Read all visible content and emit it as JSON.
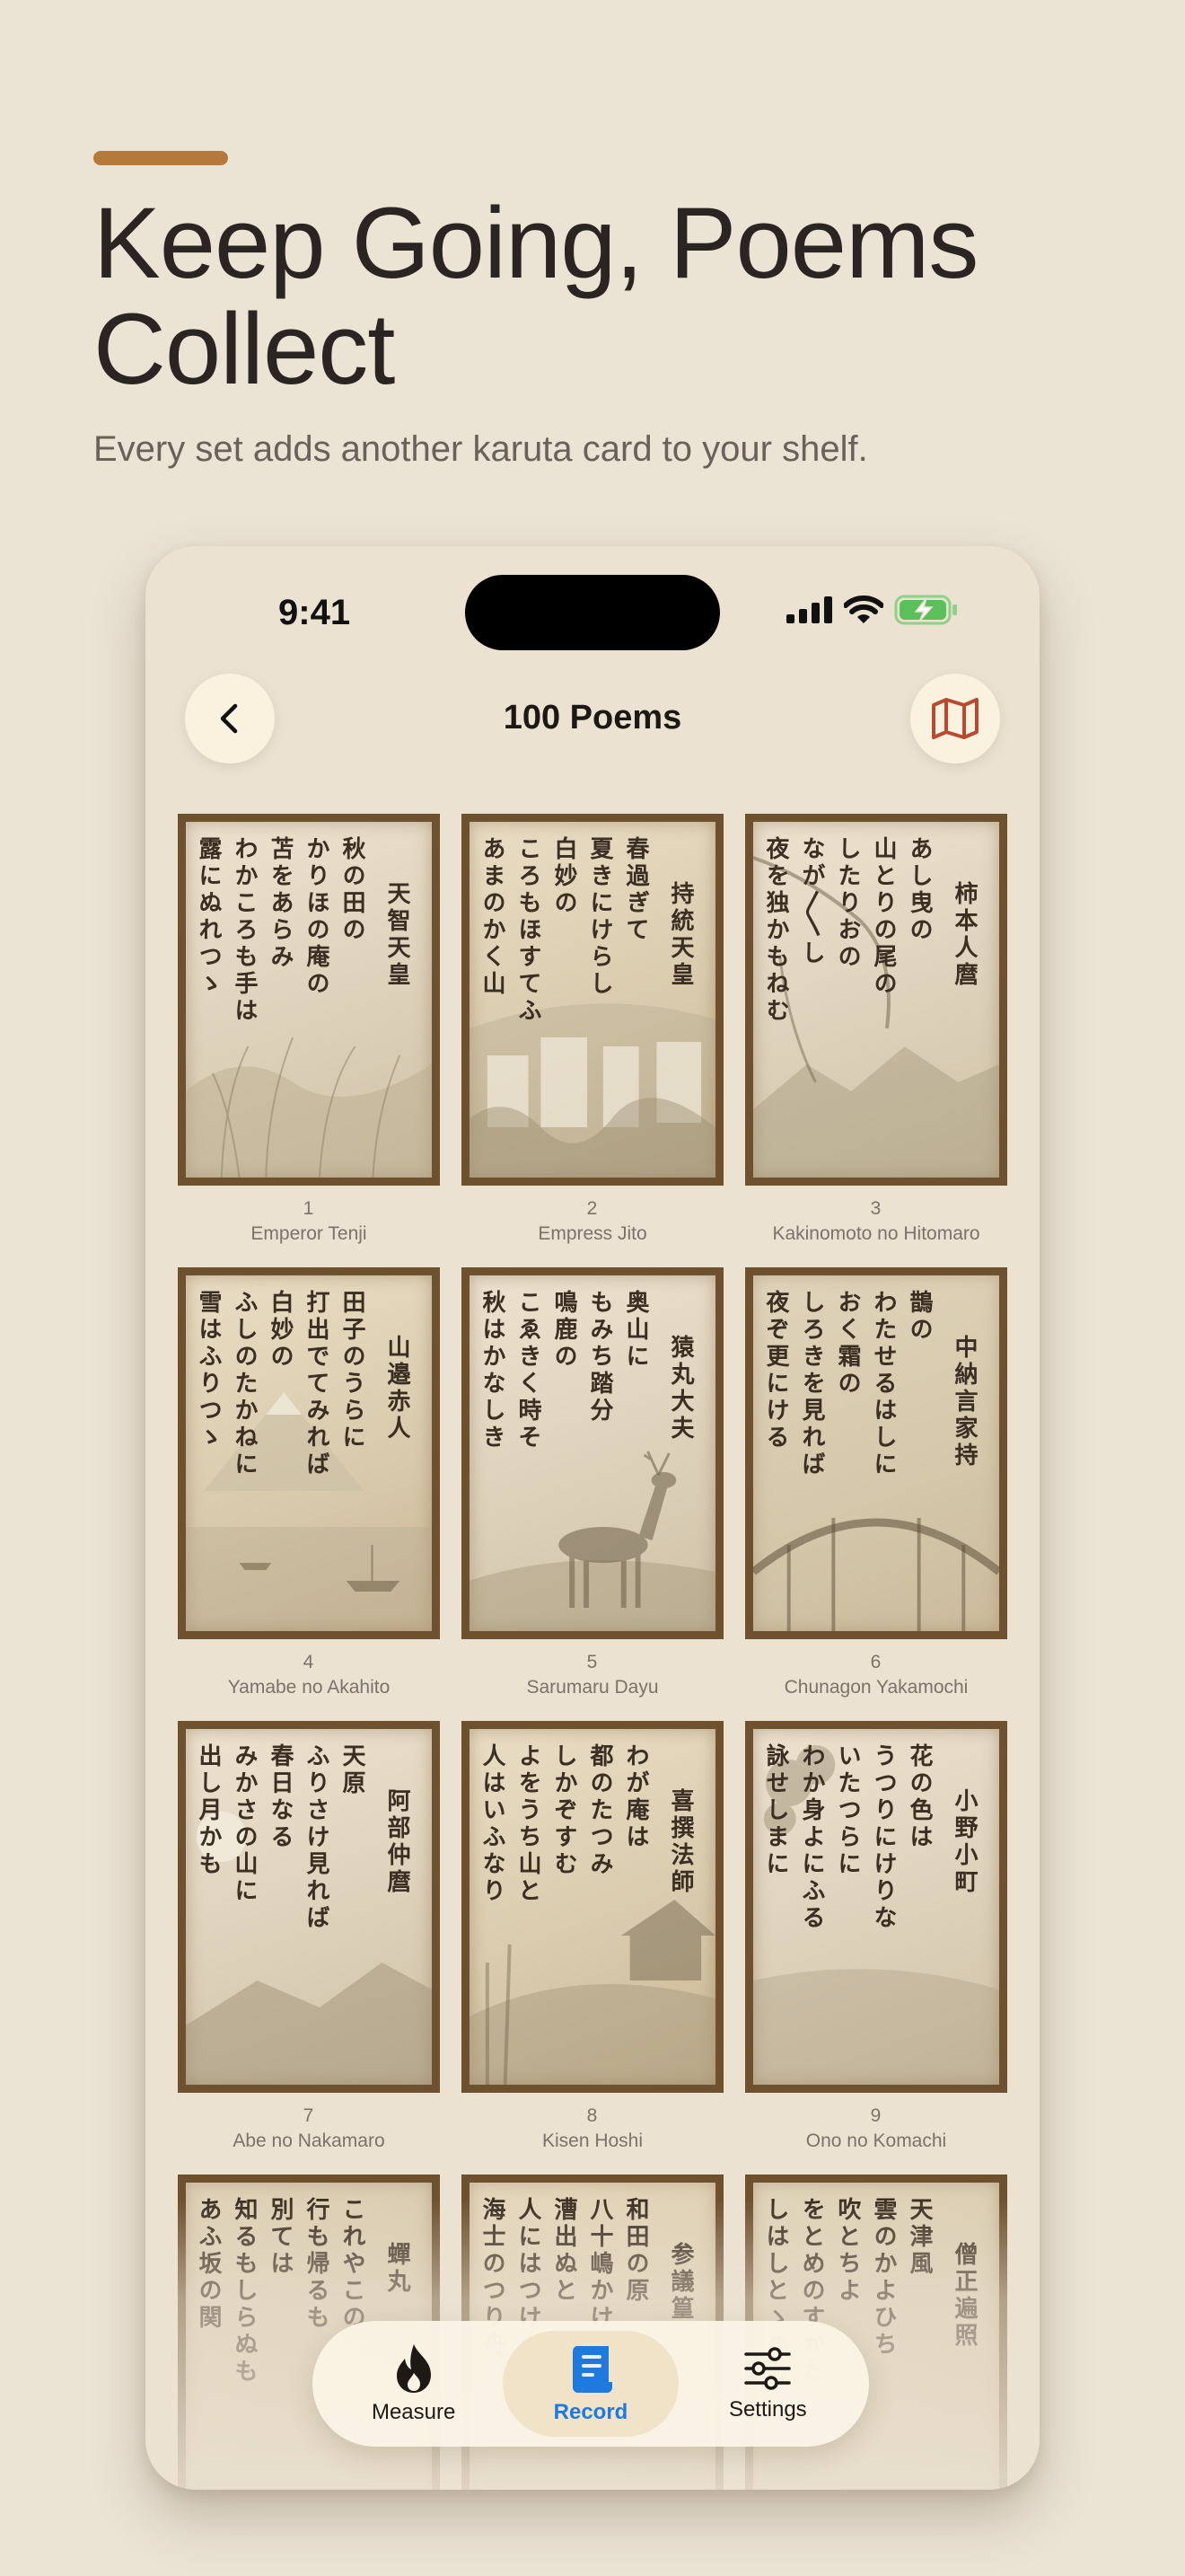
{
  "promo": {
    "headline": "Keep Going, Poems Collect",
    "subhead": "Every set adds another karuta card to your shelf."
  },
  "status_bar": {
    "time": "9:41",
    "icons": [
      "cellular-signal-icon",
      "wifi-icon",
      "battery-charging-icon"
    ]
  },
  "nav": {
    "title": "100 Poems",
    "back_icon": "chevron-left-icon",
    "map_icon": "map-icon"
  },
  "cards": [
    {
      "number": "1",
      "name": "Emperor Tenji",
      "author": "天智天皇",
      "lines": [
        "秋の田の",
        "かりほの庵の",
        "苫をあらみ",
        "わかころも手は",
        "露にぬれつゝ"
      ],
      "art": "rice-field"
    },
    {
      "number": "2",
      "name": "Empress Jito",
      "author": "持統天皇",
      "lines": [
        "春過ぎて",
        "夏きにけらし",
        "白妙の",
        "ころもほすてふ",
        "あまのかく山"
      ],
      "art": "hanging-cloth"
    },
    {
      "number": "3",
      "name": "Kakinomoto no Hitomaro",
      "author": "柿本人麿",
      "lines": [
        "あし曳の",
        "山とりの尾の",
        "したりおの",
        "なが〳〵し",
        "夜を独かもねむ"
      ],
      "art": "pheasant-mountains"
    },
    {
      "number": "4",
      "name": "Yamabe no Akahito",
      "author": "山邉赤人",
      "lines": [
        "田子のうらに",
        "打出でてみれば",
        "白妙の",
        "ふしのたかねに",
        "雪はふりつゝ"
      ],
      "art": "mount-fuji"
    },
    {
      "number": "5",
      "name": "Sarumaru Dayu",
      "author": "猿丸大夫",
      "lines": [
        "奥山に",
        "もみち踏分",
        "鳴鹿の",
        "こゑきく時そ",
        "秋はかなしき"
      ],
      "art": "deer"
    },
    {
      "number": "6",
      "name": "Chunagon Yakamochi",
      "author": "中納言家持",
      "lines": [
        "鵲の",
        "わたせるはしに",
        "おく霜の",
        "しろきを見れば",
        "夜ぞ更にける"
      ],
      "art": "bridge"
    },
    {
      "number": "7",
      "name": "Abe no Nakamaro",
      "author": "阿部仲麿",
      "lines": [
        "天原",
        "ふりさけ見れば",
        "春日なる",
        "みかさの山に",
        "出し月かも"
      ],
      "art": "moon-mountains"
    },
    {
      "number": "8",
      "name": "Kisen Hoshi",
      "author": "喜撰法師",
      "lines": [
        "わが庵は",
        "都のたつみ",
        "しかぞすむ",
        "よをうち山と",
        "人はいふなり"
      ],
      "art": "hut"
    },
    {
      "number": "9",
      "name": "Ono no Komachi",
      "author": "小野小町",
      "lines": [
        "花の色は",
        "うつりにけりな",
        "いたつらに",
        "わか身よにふる",
        "詠せしまに"
      ],
      "art": "blossom"
    },
    {
      "number": "",
      "name": "",
      "author": "蟬丸",
      "lines": [
        "これやこの",
        "行も帰るも",
        "別ては",
        "知るもしらぬも",
        "あふ坂の関"
      ],
      "art": "gate"
    },
    {
      "number": "",
      "name": "",
      "author": "参議篁",
      "lines": [
        "和田の原",
        "八十嶋かけて",
        "漕出ぬと",
        "人にはつけよ",
        "海士のつり舟"
      ],
      "art": "sea"
    },
    {
      "number": "",
      "name": "",
      "author": "僧正遍照",
      "lines": [
        "天津風",
        "雲のかよひち",
        "吹とちよ",
        "をとめのすかた",
        "しはしとゝめむ"
      ],
      "art": "clouds"
    }
  ],
  "tabbar": {
    "tabs": [
      {
        "label": "Measure",
        "icon": "flame-icon",
        "active": false
      },
      {
        "label": "Record",
        "icon": "scroll-icon",
        "active": true
      },
      {
        "label": "Settings",
        "icon": "sliders-icon",
        "active": false
      }
    ]
  },
  "colors": {
    "background": "#ebe3d4",
    "accent": "#b5793c",
    "card_frame": "#6e5230",
    "active_tab": "#1f7ae0"
  }
}
